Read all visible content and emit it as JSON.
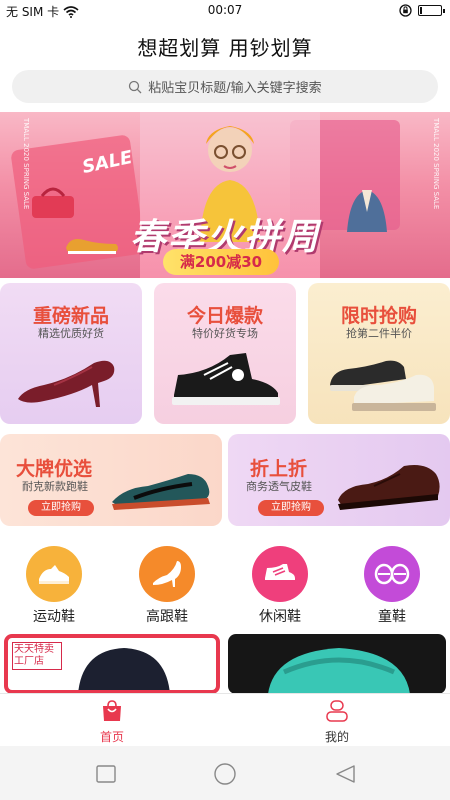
{
  "status": {
    "carrier": "无 SIM 卡",
    "time": "00:07"
  },
  "app": {
    "title": "想超划算  用钞划算"
  },
  "search": {
    "placeholder": "粘贴宝贝标题/输入关键字搜索"
  },
  "banner": {
    "headline": "春季火拼周",
    "promo": "满200减30",
    "sale_text": "SALE",
    "side_text": "TMALL 2020  SPRING SALE"
  },
  "promo_cards": [
    {
      "title": "重磅新品",
      "subtitle": "精选优质好货",
      "color": "#e84f3c"
    },
    {
      "title": "今日爆款",
      "subtitle": "特价好货专场",
      "color": "#e84f3c"
    },
    {
      "title": "限时抢购",
      "subtitle": "抢第二件半价",
      "color": "#e84f3c"
    },
    {
      "title": "大牌优选",
      "subtitle": "耐克新款跑鞋",
      "button": "立即抢购",
      "color": "#e84f3c"
    },
    {
      "title": "折上折",
      "subtitle": "商务透气皮鞋",
      "button": "立即抢购",
      "color": "#e84f3c"
    }
  ],
  "categories": [
    {
      "label": "运动鞋",
      "icon": "sneaker-icon",
      "color": "#f7b23b"
    },
    {
      "label": "高跟鞋",
      "icon": "high-heel-icon",
      "color": "#f58a2a"
    },
    {
      "label": "休闲鞋",
      "icon": "casual-shoe-icon",
      "color": "#ef3f7c"
    },
    {
      "label": "童鞋",
      "icon": "kids-shoe-icon",
      "color": "#c34bd8"
    }
  ],
  "thumbs": [
    {
      "store_badge": "天天特卖 工厂店"
    }
  ],
  "tabs": [
    {
      "label": "首页",
      "active": true,
      "icon": "home-bag-icon",
      "color": "#e8384e"
    },
    {
      "label": "我的",
      "active": false,
      "icon": "profile-icon",
      "color": "#333333"
    }
  ],
  "accent": "#e8384e"
}
